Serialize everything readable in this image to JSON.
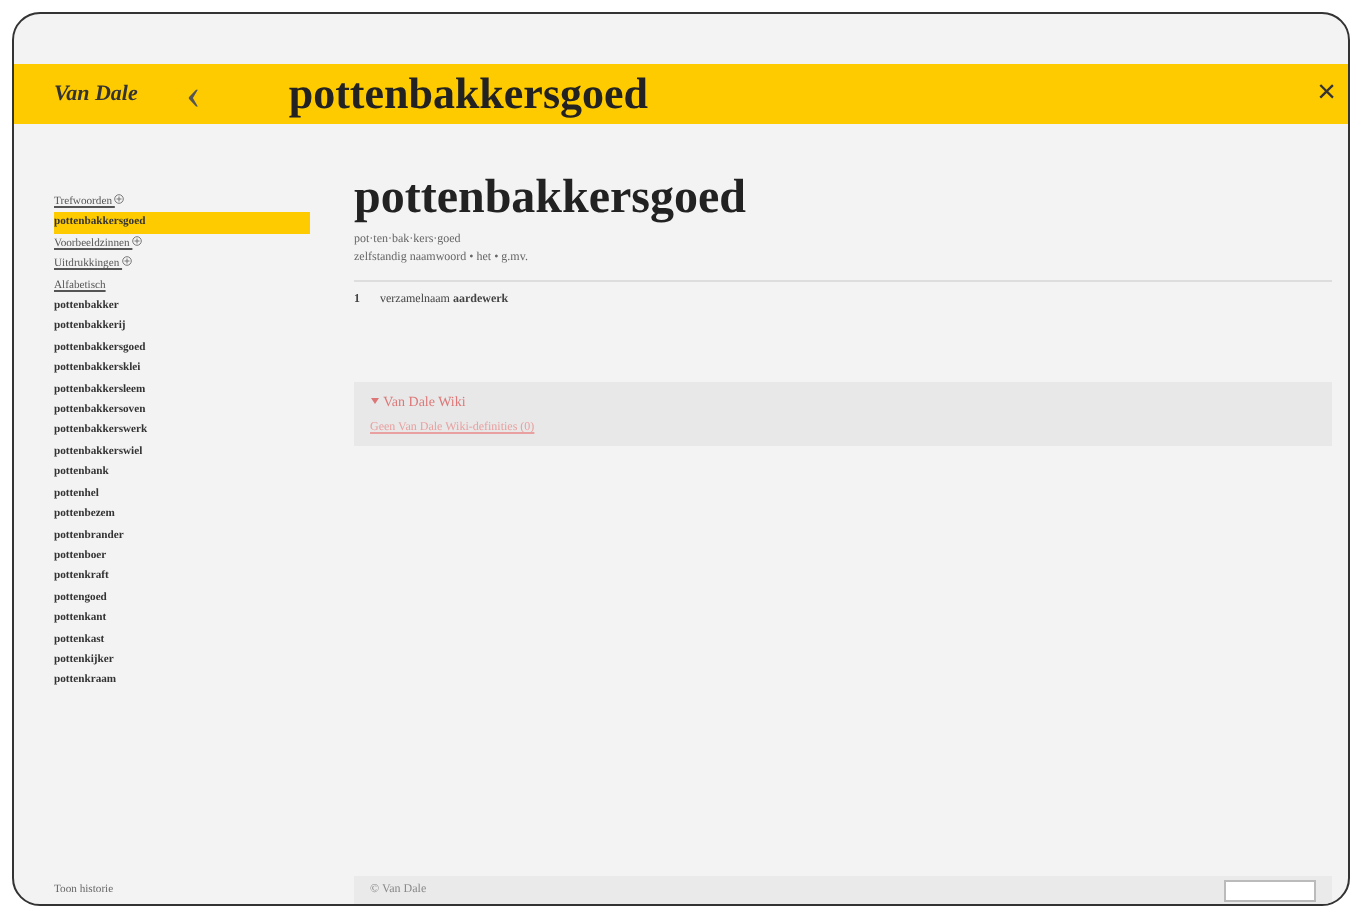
{
  "header": {
    "logo": "Van Dale",
    "back": "‹",
    "title": "pottenbakkersgoed",
    "close": "×"
  },
  "sidebar": {
    "links": [
      {
        "label": "Trefwoorden",
        "kind": "link",
        "selected": false
      },
      {
        "label": "pottenbakkersgoed",
        "kind": "item",
        "selected": true
      },
      {
        "label": "Voorbeeldzinnen",
        "kind": "link",
        "selected": false
      },
      {
        "label": "Uitdrukkingen",
        "kind": "link",
        "selected": false
      },
      {
        "label": "Alfabetisch",
        "kind": "heading",
        "selected": false
      }
    ],
    "words": [
      {
        "label": "pottenbakker",
        "selected": false
      },
      {
        "label": "pottenbakkerij",
        "selected": false
      },
      {
        "label": "pottenbakkersgoed",
        "selected": false
      },
      {
        "label": "pottenbakkersklei",
        "selected": false
      },
      {
        "label": "pottenbakkersleem",
        "selected": false
      },
      {
        "label": "pottenbakkersoven",
        "selected": false
      },
      {
        "label": "pottenbakkerswerk",
        "selected": false
      },
      {
        "label": "pottenbakkerswiel",
        "selected": false
      },
      {
        "label": "pottenbank",
        "selected": false
      },
      {
        "label": "pottenhel",
        "selected": false
      },
      {
        "label": "pottenbezem",
        "selected": false
      },
      {
        "label": "pottenbrander",
        "selected": false
      },
      {
        "label": "pottenboer",
        "selected": false
      },
      {
        "label": "pottenkraft",
        "selected": false
      },
      {
        "label": "pottengoed",
        "selected": false
      },
      {
        "label": "pottenkant",
        "selected": false
      },
      {
        "label": "pottenkast",
        "selected": false
      },
      {
        "label": "pottenkijker",
        "selected": false
      },
      {
        "label": "pottenkraam",
        "selected": false
      }
    ],
    "footer": "Toon historie"
  },
  "entry": {
    "headword": "pottenbakkersgoed",
    "syllables": "pot·ten·bak·kers·goed",
    "grammar": "zelfstandig naamwoord • het • g.mv.",
    "senses": [
      {
        "number": "1",
        "label": "verzamelnaam",
        "text": "aardewerk"
      }
    ],
    "wiki": {
      "title": "Van Dale Wiki",
      "expanded": true,
      "link": "Geen Van Dale Wiki-definities (0)"
    }
  },
  "footer": {
    "text": "© Van Dale"
  }
}
